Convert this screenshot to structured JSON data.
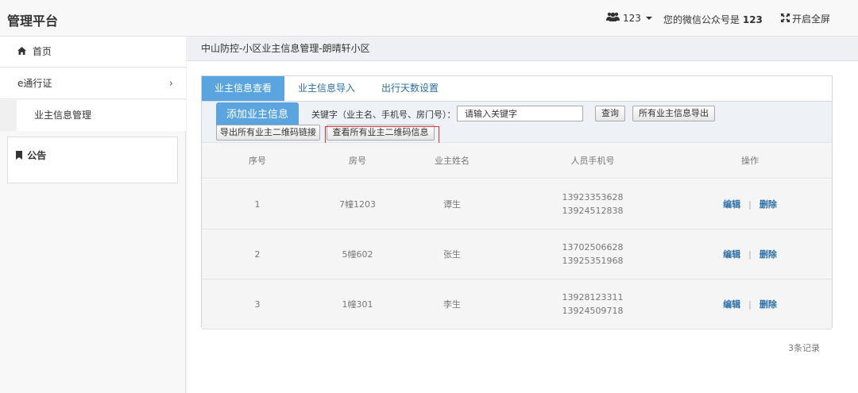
{
  "header": {
    "brand": "管理平台",
    "user_label": "123",
    "wechat_prefix": "您的微信公众号是",
    "wechat_id": "123",
    "fullscreen_label": "开启全屏"
  },
  "sidebar": {
    "items": [
      {
        "label": "首页",
        "icon": "home-icon"
      },
      {
        "label": "e通行证",
        "icon": "chevron-right-icon"
      },
      {
        "label": "业主信息管理"
      }
    ],
    "notice_label": "公告"
  },
  "main": {
    "breadcrumb": "中山防控-小区业主信息管理-朗晴轩小区",
    "tabs": [
      {
        "label": "业主信息查看",
        "active": true
      },
      {
        "label": "业主信息导入",
        "active": false
      },
      {
        "label": "出行天数设置",
        "active": false
      }
    ],
    "toolbar": {
      "add_label": "添加业主信息",
      "keyword_label": "关键字（业主名、手机号、房门号）：",
      "keyword_placeholder": "请输入关键字",
      "search_label": "查询",
      "export_all_label": "所有业主信息导出",
      "export_qr_links_label": "导出所有业主二维码链接",
      "view_qr_info_label": "查看所有业主二维码信息"
    },
    "table": {
      "headers": [
        "序号",
        "房号",
        "业主姓名",
        "人员手机号",
        "操作"
      ],
      "rows": [
        {
          "index": "1",
          "room": "7幢1203",
          "name": "谭生",
          "phones": [
            "13923353628",
            "13924512838"
          ]
        },
        {
          "index": "2",
          "room": "5幢602",
          "name": "张生",
          "phones": [
            "13702506628",
            "13925351968"
          ]
        },
        {
          "index": "3",
          "room": "1幢301",
          "name": "李生",
          "phones": [
            "13928123311",
            "13924509718"
          ]
        }
      ],
      "edit_label": "编辑",
      "delete_label": "删除",
      "separator": "|"
    },
    "records": "3条记录"
  },
  "colors": {
    "accent": "#5aa5e0",
    "link": "#2a6fa8",
    "highlight": "#d9323a"
  }
}
